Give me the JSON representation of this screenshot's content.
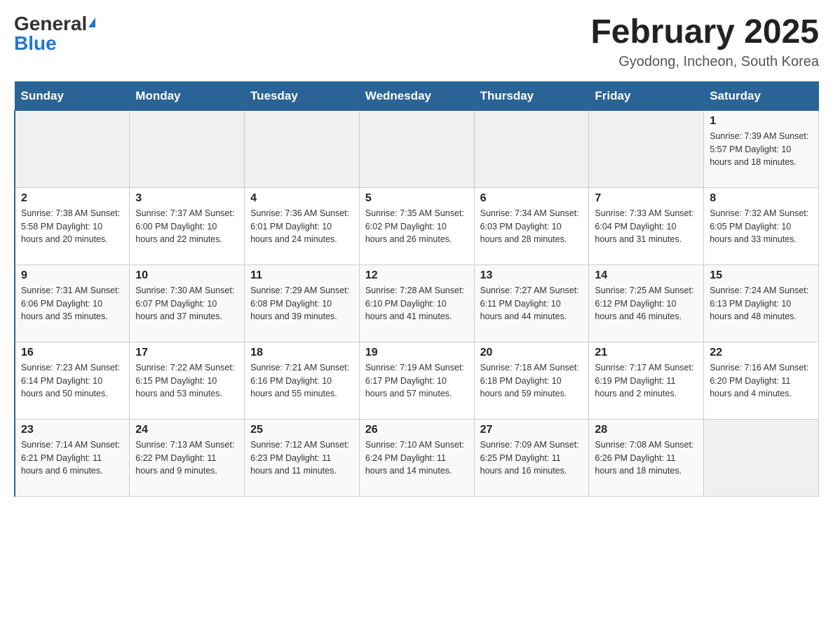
{
  "header": {
    "logo_general": "General",
    "logo_blue": "Blue",
    "title": "February 2025",
    "subtitle": "Gyodong, Incheon, South Korea"
  },
  "days_of_week": [
    "Sunday",
    "Monday",
    "Tuesday",
    "Wednesday",
    "Thursday",
    "Friday",
    "Saturday"
  ],
  "weeks": [
    [
      {
        "day": "",
        "info": ""
      },
      {
        "day": "",
        "info": ""
      },
      {
        "day": "",
        "info": ""
      },
      {
        "day": "",
        "info": ""
      },
      {
        "day": "",
        "info": ""
      },
      {
        "day": "",
        "info": ""
      },
      {
        "day": "1",
        "info": "Sunrise: 7:39 AM\nSunset: 5:57 PM\nDaylight: 10 hours and 18 minutes."
      }
    ],
    [
      {
        "day": "2",
        "info": "Sunrise: 7:38 AM\nSunset: 5:58 PM\nDaylight: 10 hours and 20 minutes."
      },
      {
        "day": "3",
        "info": "Sunrise: 7:37 AM\nSunset: 6:00 PM\nDaylight: 10 hours and 22 minutes."
      },
      {
        "day": "4",
        "info": "Sunrise: 7:36 AM\nSunset: 6:01 PM\nDaylight: 10 hours and 24 minutes."
      },
      {
        "day": "5",
        "info": "Sunrise: 7:35 AM\nSunset: 6:02 PM\nDaylight: 10 hours and 26 minutes."
      },
      {
        "day": "6",
        "info": "Sunrise: 7:34 AM\nSunset: 6:03 PM\nDaylight: 10 hours and 28 minutes."
      },
      {
        "day": "7",
        "info": "Sunrise: 7:33 AM\nSunset: 6:04 PM\nDaylight: 10 hours and 31 minutes."
      },
      {
        "day": "8",
        "info": "Sunrise: 7:32 AM\nSunset: 6:05 PM\nDaylight: 10 hours and 33 minutes."
      }
    ],
    [
      {
        "day": "9",
        "info": "Sunrise: 7:31 AM\nSunset: 6:06 PM\nDaylight: 10 hours and 35 minutes."
      },
      {
        "day": "10",
        "info": "Sunrise: 7:30 AM\nSunset: 6:07 PM\nDaylight: 10 hours and 37 minutes."
      },
      {
        "day": "11",
        "info": "Sunrise: 7:29 AM\nSunset: 6:08 PM\nDaylight: 10 hours and 39 minutes."
      },
      {
        "day": "12",
        "info": "Sunrise: 7:28 AM\nSunset: 6:10 PM\nDaylight: 10 hours and 41 minutes."
      },
      {
        "day": "13",
        "info": "Sunrise: 7:27 AM\nSunset: 6:11 PM\nDaylight: 10 hours and 44 minutes."
      },
      {
        "day": "14",
        "info": "Sunrise: 7:25 AM\nSunset: 6:12 PM\nDaylight: 10 hours and 46 minutes."
      },
      {
        "day": "15",
        "info": "Sunrise: 7:24 AM\nSunset: 6:13 PM\nDaylight: 10 hours and 48 minutes."
      }
    ],
    [
      {
        "day": "16",
        "info": "Sunrise: 7:23 AM\nSunset: 6:14 PM\nDaylight: 10 hours and 50 minutes."
      },
      {
        "day": "17",
        "info": "Sunrise: 7:22 AM\nSunset: 6:15 PM\nDaylight: 10 hours and 53 minutes."
      },
      {
        "day": "18",
        "info": "Sunrise: 7:21 AM\nSunset: 6:16 PM\nDaylight: 10 hours and 55 minutes."
      },
      {
        "day": "19",
        "info": "Sunrise: 7:19 AM\nSunset: 6:17 PM\nDaylight: 10 hours and 57 minutes."
      },
      {
        "day": "20",
        "info": "Sunrise: 7:18 AM\nSunset: 6:18 PM\nDaylight: 10 hours and 59 minutes."
      },
      {
        "day": "21",
        "info": "Sunrise: 7:17 AM\nSunset: 6:19 PM\nDaylight: 11 hours and 2 minutes."
      },
      {
        "day": "22",
        "info": "Sunrise: 7:16 AM\nSunset: 6:20 PM\nDaylight: 11 hours and 4 minutes."
      }
    ],
    [
      {
        "day": "23",
        "info": "Sunrise: 7:14 AM\nSunset: 6:21 PM\nDaylight: 11 hours and 6 minutes."
      },
      {
        "day": "24",
        "info": "Sunrise: 7:13 AM\nSunset: 6:22 PM\nDaylight: 11 hours and 9 minutes."
      },
      {
        "day": "25",
        "info": "Sunrise: 7:12 AM\nSunset: 6:23 PM\nDaylight: 11 hours and 11 minutes."
      },
      {
        "day": "26",
        "info": "Sunrise: 7:10 AM\nSunset: 6:24 PM\nDaylight: 11 hours and 14 minutes."
      },
      {
        "day": "27",
        "info": "Sunrise: 7:09 AM\nSunset: 6:25 PM\nDaylight: 11 hours and 16 minutes."
      },
      {
        "day": "28",
        "info": "Sunrise: 7:08 AM\nSunset: 6:26 PM\nDaylight: 11 hours and 18 minutes."
      },
      {
        "day": "",
        "info": ""
      }
    ]
  ]
}
